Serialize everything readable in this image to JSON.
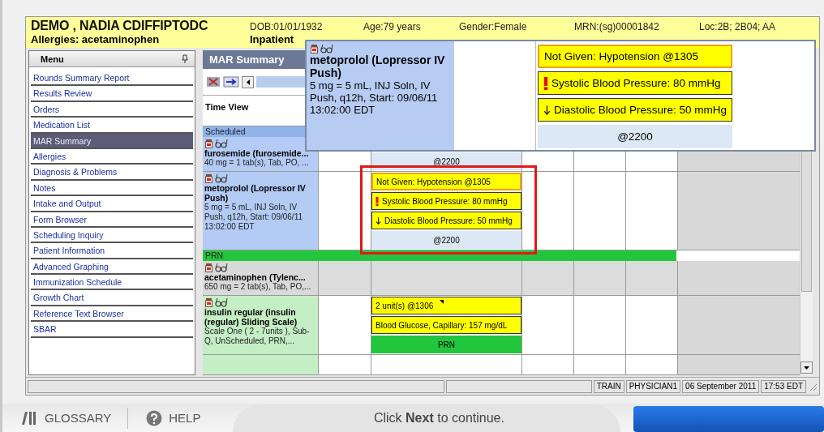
{
  "patient": {
    "name": "DEMO , NADIA CDIFFIPTODC",
    "dob": "DOB:01/01/1932",
    "age": "Age:79 years",
    "gender": "Gender:Female",
    "mrn": "MRN:(sg)00001842",
    "location": "Loc:2B; 2B04; AA",
    "allergies": "Allergies: acetaminophen",
    "encounter": "Inpatient"
  },
  "menu": {
    "title": "Menu",
    "items": [
      {
        "label": "Rounds Summary Report",
        "selected": false
      },
      {
        "label": "Results Review",
        "selected": false
      },
      {
        "label": "Orders",
        "selected": false
      },
      {
        "label": "Medication List",
        "selected": false
      },
      {
        "label": "MAR Summary",
        "selected": true
      },
      {
        "label": "Allergies",
        "selected": false
      },
      {
        "label": "Diagnosis & Problems",
        "selected": false
      },
      {
        "label": "Notes",
        "selected": false
      },
      {
        "label": "Intake and Output",
        "selected": false
      },
      {
        "label": "Form Browser",
        "selected": false
      },
      {
        "label": "Scheduling Inquiry",
        "selected": false
      },
      {
        "label": "Patient Information",
        "selected": false
      },
      {
        "label": "Advanced Graphing",
        "selected": false
      },
      {
        "label": "Immunization Schedule",
        "selected": false
      },
      {
        "label": "Growth Chart",
        "selected": false
      },
      {
        "label": "Reference Text Browser",
        "selected": false
      },
      {
        "label": "SBAR",
        "selected": false
      }
    ]
  },
  "mar": {
    "title": "MAR Summary",
    "time_view": "Time View",
    "rows": [
      {
        "kind": "section",
        "label": "Scheduled",
        "color": "#8fb4ec"
      },
      {
        "kind": "med",
        "name": "furosemide (furosemide...",
        "details": "40 mg = 1 tab(s), Tab, PO,  ...",
        "color": "#b3cbf5",
        "greyed": false,
        "entries": [
          {
            "kind": "scheduled",
            "text": "@2200"
          }
        ]
      },
      {
        "kind": "med",
        "name": "metoprolol (Lopressor IV Push)",
        "details": "5 mg = 5 mL, INJ Soln, IV Push, q12h, Start: 09/06/11 13:02:00 EDT",
        "color": "#b3cbf5",
        "greyed": false,
        "entries": [
          {
            "kind": "not-given",
            "text": "Not Given: Hypotension @1305"
          },
          {
            "kind": "critical",
            "text": "Systolic Blood Pressure: 80 mmHg"
          },
          {
            "kind": "low",
            "text": "Diastolic Blood Pressure: 50 mmHg"
          },
          {
            "kind": "scheduled",
            "text": "@2200"
          }
        ]
      },
      {
        "kind": "section",
        "label": "PRN",
        "color": "#22c63c"
      },
      {
        "kind": "med",
        "name": "acetaminophen (Tylenc...",
        "details": "650 mg = 2 tab(s), Tab, PO,...",
        "color": "#d9d9d9",
        "greyed": true,
        "entries": []
      },
      {
        "kind": "med",
        "name": "insulin regular (insulin (regular) Sliding Scale)",
        "details": "Scale One ( 2 - 7units ), Sub-Q, UnScheduled, PRN,...",
        "color": "#c4eec4",
        "greyed": false,
        "entries": [
          {
            "kind": "given",
            "text": "2 unit(s) @1306"
          },
          {
            "kind": "result",
            "text": "Blood Glucose, Capillary: 157 mg/dL"
          },
          {
            "kind": "prn",
            "text": "PRN"
          }
        ]
      }
    ]
  },
  "popup": {
    "name": "metoprolol (Lopressor IV Push)",
    "details": "5 mg = 5 mL, INJ Soln, IV Push, q12h, Start: 09/06/11 13:02:00 EDT",
    "entries": [
      {
        "kind": "not-given",
        "text": "Not Given: Hypotension @1305"
      },
      {
        "kind": "critical",
        "text": "Systolic Blood Pressure: 80 mmHg"
      },
      {
        "kind": "low",
        "text": "Diastolic Blood Pressure: 50 mmHg"
      },
      {
        "kind": "scheduled",
        "text": "@2200"
      }
    ]
  },
  "status_bar": [
    "TRAIN",
    "PHYSICIAN1",
    "06 September 2011",
    "17:53 EDT"
  ],
  "footer": {
    "glossary": "GLOSSARY",
    "help": "HELP",
    "instruction": "Click **Next** to continue."
  }
}
